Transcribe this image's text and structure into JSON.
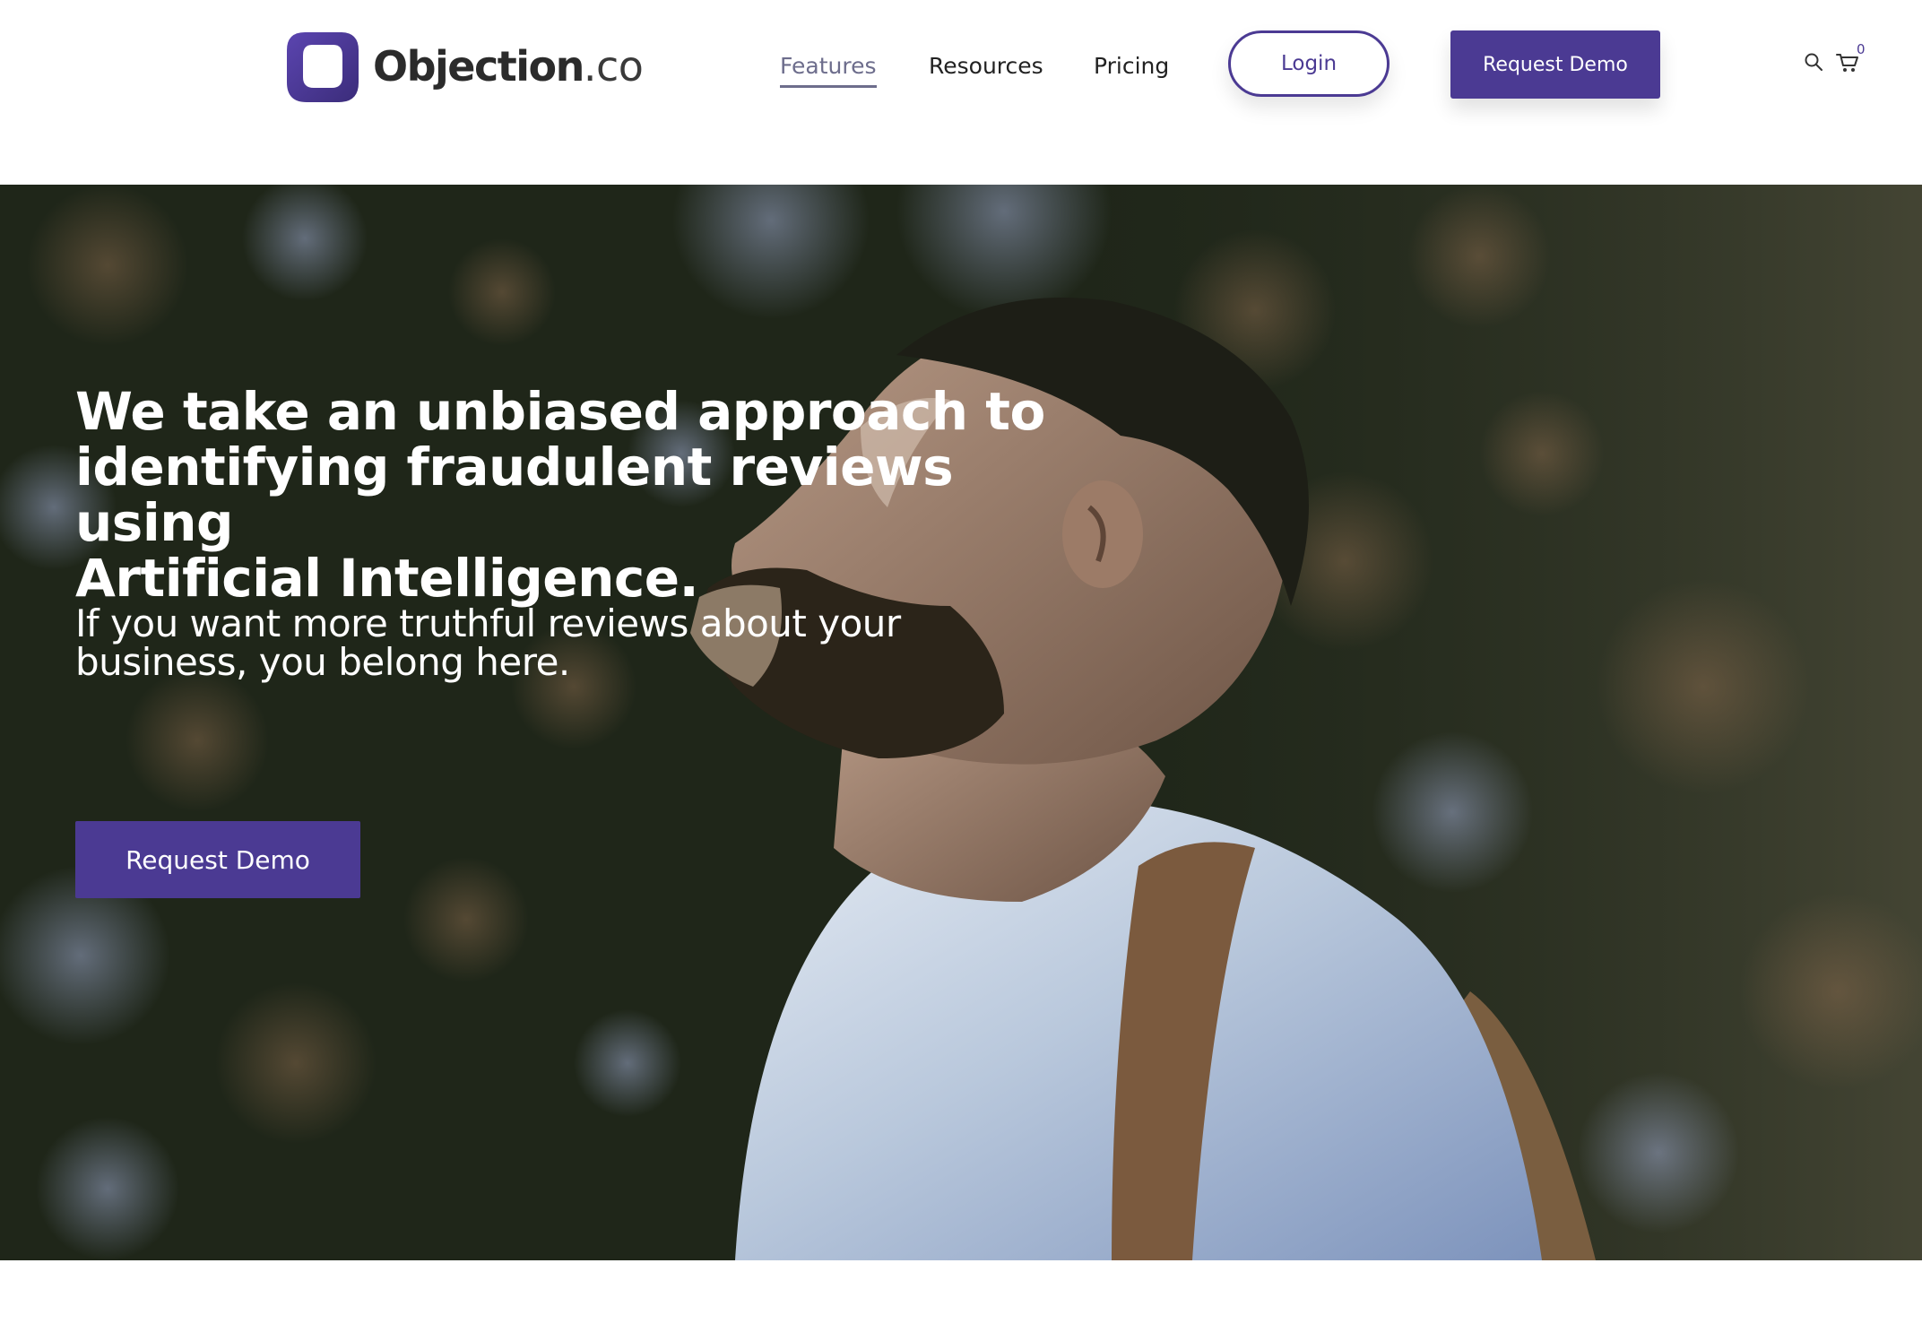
{
  "brand": {
    "name": "Objection",
    "suffix": ".co",
    "icon": "logo-o-icon",
    "color": "#4b3a93"
  },
  "nav": {
    "items": [
      {
        "label": "Features",
        "active": true
      },
      {
        "label": "Resources",
        "active": false
      },
      {
        "label": "Pricing",
        "active": false
      }
    ],
    "login_label": "Login",
    "demo_label": "Request Demo",
    "search_icon": "search-icon",
    "cart_icon": "cart-icon",
    "cart_count": "0"
  },
  "hero": {
    "title_lines": [
      "We take an unbiased approach to",
      "identifying fraudulent reviews using",
      "Artificial Intelligence."
    ],
    "subtitle_lines": [
      "If you want more truthful reviews about your",
      "business, you belong here."
    ],
    "cta_label": "Request Demo",
    "background": "photo of a bearded man with a backpack looking up in a forest"
  },
  "colors": {
    "accent": "#4b3a93",
    "active_nav": "#6d6d8c",
    "text": "#222222"
  }
}
